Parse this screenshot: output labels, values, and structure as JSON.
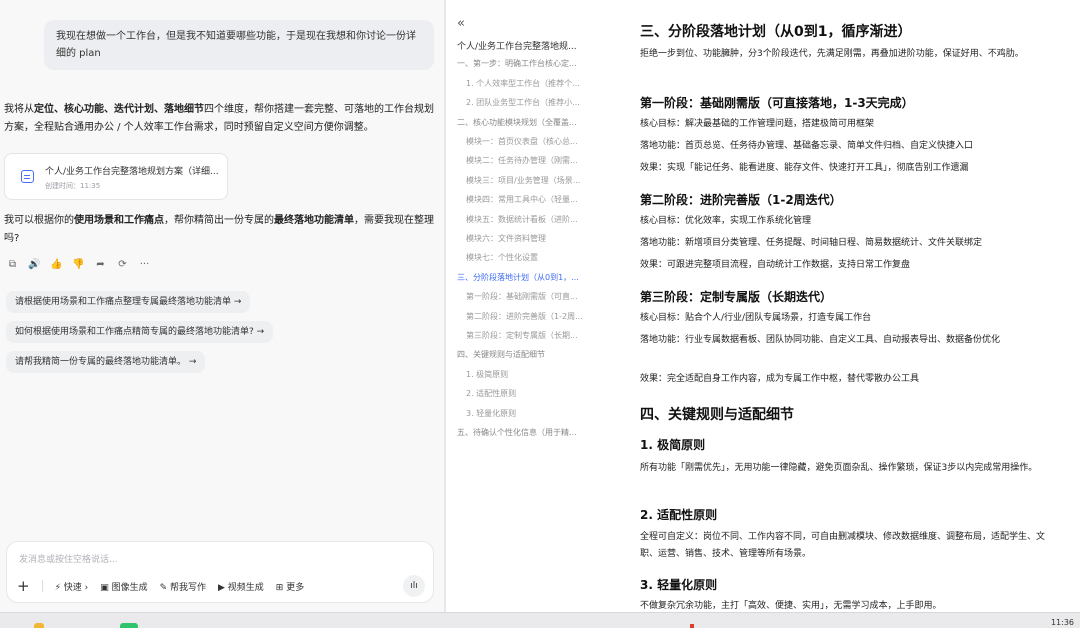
{
  "chat": {
    "user_message": "我现在想做一个工作台，但是我不知道要哪些功能，于是现在我想和你讨论一份详细的 plan",
    "reply_intro": {
      "t1": "我将从",
      "b1": "定位、核心功能、迭代计划、落地细节",
      "t2": "四个维度，帮你搭建一套完整、可落地的工作台规划方案，全程贴合通用办公 / 个人效率工作台需求，同时预留自定义空间方便你调整。"
    },
    "file_card": {
      "title": "个人/业务工作台完整落地规划方案（详细...",
      "time": "创建时间：11:35"
    },
    "reply_followup": {
      "t1": "我可以根据你的",
      "b1": "使用场景和工作痛点",
      "t2": "，帮你精简出一份专属的",
      "b2": "最终落地功能清单",
      "t3": "，需要我现在整理吗?"
    },
    "actions": [
      "⧉",
      "🔊",
      "👍",
      "👎",
      "➦",
      "⟳",
      "···"
    ],
    "suggestions": [
      "请根据使用场景和工作痛点整理专属最终落地功能清单 →",
      "如何根据使用场景和工作痛点精简专属的最终落地功能清单? →",
      "请帮我精简一份专属的最终落地功能清单。 →"
    ],
    "composer": {
      "placeholder": "发消息或按住空格说话...",
      "plus": "+",
      "tools": [
        "⚡ 快速 ›",
        "▣ 图像生成",
        "✎ 帮我写作",
        "▶ 视频生成",
        "⊞ 更多"
      ],
      "voice": "ılı"
    }
  },
  "outline": {
    "collapse": "«",
    "items": [
      {
        "text": "个人/业务工作台完整落地规...",
        "level": 0,
        "active": false
      },
      {
        "text": "一、第一步：明确工作台核心定...",
        "level": 1,
        "active": false
      },
      {
        "text": "1. 个人效率型工作台（推荐个...",
        "level": 2,
        "active": false
      },
      {
        "text": "2. 团队业务型工作台（推荐小...",
        "level": 2,
        "active": false
      },
      {
        "text": "二、核心功能模块规划（全覆盖...",
        "level": 1,
        "active": false
      },
      {
        "text": "模块一：首页仪表盘（核心总...",
        "level": 2,
        "active": false
      },
      {
        "text": "模块二：任务待办管理（刚需...",
        "level": 2,
        "active": false
      },
      {
        "text": "模块三：项目/业务管理（场景...",
        "level": 2,
        "active": false
      },
      {
        "text": "模块四：常用工具中心（轻量...",
        "level": 2,
        "active": false
      },
      {
        "text": "模块五：数据统计看板（进阶...",
        "level": 2,
        "active": false
      },
      {
        "text": "模块六：文件资料管理",
        "level": 2,
        "active": false
      },
      {
        "text": "模块七：个性化设置",
        "level": 2,
        "active": false
      },
      {
        "text": "三、分阶段落地计划（从0到1，...",
        "level": 1,
        "active": true
      },
      {
        "text": "第一阶段：基础刚需版（可直...",
        "level": 2,
        "active": false
      },
      {
        "text": "第二阶段：进阶完善版（1-2周...",
        "level": 2,
        "active": false
      },
      {
        "text": "第三阶段：定制专属版（长期...",
        "level": 2,
        "active": false
      },
      {
        "text": "四、关键规则与适配细节",
        "level": 1,
        "active": false
      },
      {
        "text": "1. 极简原则",
        "level": 2,
        "active": false
      },
      {
        "text": "2. 适配性原则",
        "level": 2,
        "active": false
      },
      {
        "text": "3. 轻量化原则",
        "level": 2,
        "active": false
      },
      {
        "text": "五、待确认个性化信息（用于精...",
        "level": 1,
        "active": false
      }
    ]
  },
  "doc": {
    "sec3_title": "三、分阶段落地计划（从0到1，循序渐进）",
    "sec3_intro": "拒绝一步到位、功能臃肿，分3个阶段迭代，先满足刚需，再叠加进阶功能，保证好用、不鸡肋。",
    "phase1_title": "第一阶段：基础刚需版（可直接落地，1-3天完成）",
    "phase1_goal": "核心目标：解决最基础的工作管理问题，搭建极简可用框架",
    "phase1_feat": "落地功能：首页总览、任务待办管理、基础备忘录、简单文件归档、自定义快捷入口",
    "phase1_eff": "效果：实现「能记任务、能看进度、能存文件、快速打开工具」，彻底告别工作遗漏",
    "phase2_title": "第二阶段：进阶完善版（1-2周迭代）",
    "phase2_goal": "核心目标：优化效率，实现工作系统化管理",
    "phase2_feat": "落地功能：新增项目分类管理、任务提醒、时间轴日程、简易数据统计、文件关联绑定",
    "phase2_eff": "效果：可跟进完整项目流程，自动统计工作数据，支持日常工作复盘",
    "phase3_title": "第三阶段：定制专属版（长期迭代）",
    "phase3_goal": "核心目标：贴合个人/行业/团队专属场景，打造专属工作台",
    "phase3_feat": "落地功能：行业专属数据看板、团队协同功能、自定义工具、自动报表导出、数据备份优化",
    "phase3_eff": "效果：完全适配自身工作内容，成为专属工作中枢，替代零散办公工具",
    "sec4_title": "四、关键规则与适配细节",
    "rule1_title": "1. 极简原则",
    "rule1_text": "所有功能「刚需优先」，无用功能一律隐藏，避免页面杂乱、操作繁琐，保证3步以内完成常用操作。",
    "rule2_title": "2. 适配性原则",
    "rule2_text": "全程可自定义：岗位不同、工作内容不同，可自由删减模块、修改数据维度、调整布局，适配学生、文职、运营、销售、技术、管理等所有场景。",
    "rule3_title": "3. 轻量化原则",
    "rule3_text": "不做复杂冗余功能，主打「高效、便捷、实用」，无需学习成本，上手即用。"
  },
  "taskbar": {
    "clock": "11:36"
  }
}
